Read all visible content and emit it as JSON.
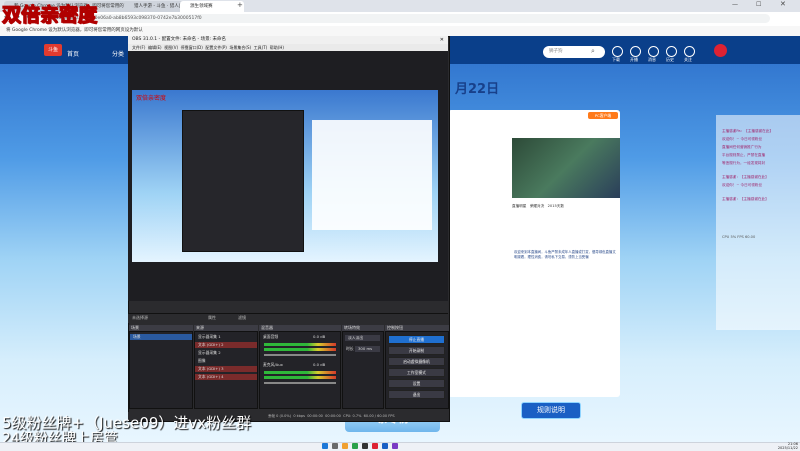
{
  "overlay": {
    "top_text": "双倍亲密度",
    "preview_text": "双倍亲密度",
    "bottom_line1": "5级粉丝牌+（Juese09）进vx粉丝群",
    "bottom_line2": "24级粉丝牌上房管"
  },
  "browser": {
    "tabs": [
      {
        "label": "和 Google Chrome 设为默认浏览器，即可将您常用的网页...",
        "active": false
      },
      {
        "label": "猎人手游 - 斗鱼 · 猎人直播间",
        "active": false
      },
      {
        "label": "源生领域赛",
        "active": true
      }
    ],
    "url": "02160938&sysId=20e06a0-ab8b6593c098370-0742e7b3000517f0",
    "infobar": "将 Google Chrome 设为默认浏览器，即可将您常用的网页设为默认"
  },
  "site": {
    "nav": [
      "首页",
      "分类"
    ],
    "search_placeholder": "狮子狗",
    "header_icons": [
      "下载",
      "开播",
      "消息",
      "历史",
      "关注"
    ],
    "date_banner": "月22日",
    "bottom_banner": "凛冬榜",
    "rules_button": "规则说明",
    "stream": {
      "badge": "PC客户端",
      "tabs": [
        "直播明星",
        "荣耀对决",
        "2015天数"
      ],
      "bullets": [
        "欢迎来到本直播间，斗鱼严禁未成年人直播或打赏，倡导绿色直播文明观看，理性消费，请勿私下交易，谨防上当受骗",
        "4级粉丝牌上房管"
      ]
    },
    "chat": [
      "主播感谢Pa：【主播感谢在此】",
      "欢迎你！~ 今日可领粉丝",
      "直播间任何营销推广行为",
      "平台规则禁止，严禁在直播",
      "等违规行为，一经发现将封",
      "主播感谢：【主播感谢在此】",
      "欢迎你！~ 今日可领粉丝",
      "主播感谢：【主播感谢在此】"
    ],
    "chat_footer": "CPU 5%  FPS 60.00"
  },
  "obs": {
    "title": "OBS 31.0.1 - 配置文件: 未命名 - 场景: 未命名",
    "menu": [
      "文件(F)",
      "编辑(E)",
      "视图(V)",
      "停靠窗口(D)",
      "配置文件(P)",
      "场景集合(S)",
      "工具(T)",
      "帮助(H)"
    ],
    "source_bar": {
      "label": "未选择源",
      "props": "属性",
      "filters": "滤镜"
    },
    "panels": {
      "scenes": {
        "title": "场景",
        "items": [
          "场景"
        ]
      },
      "sources": {
        "title": "来源",
        "items": [
          "显示器采集 1",
          "文本 (GDI+) 2",
          "显示器采集 2",
          "图像",
          "文本 (GDI+) 3",
          "文本 (GDI+) 4"
        ]
      },
      "mixer": {
        "title": "混音器",
        "tracks": [
          {
            "name": "桌面音频",
            "db": "0.0 dB"
          },
          {
            "name": "麦克风/Aux",
            "db": "0.0 dB"
          }
        ]
      },
      "transitions": {
        "title": "转场特效",
        "type": "淡入淡出",
        "duration_label": "时长",
        "duration": "300 ms"
      },
      "controls": {
        "title": "控制按钮",
        "buttons": [
          "停止直播",
          "开始录制",
          "启动虚拟摄像机",
          "工作室模式",
          "设置",
          "退出"
        ]
      }
    },
    "status": [
      "丢帧 0 (0.0%)",
      "0 kbps",
      "00:00:00",
      "00:00:00",
      "CPU: 0.7%",
      "60.00 / 60.00 FPS"
    ]
  },
  "taskbar": {
    "time": "21:06",
    "date": "2025/11/22"
  },
  "colors": {
    "overlay_yellow": "#ffe34a",
    "overlay_red": "#b00000",
    "obs_bg": "#2b2b2e",
    "stop_button": "#1f6fd0",
    "nav_blue": "#0a3f8a"
  }
}
